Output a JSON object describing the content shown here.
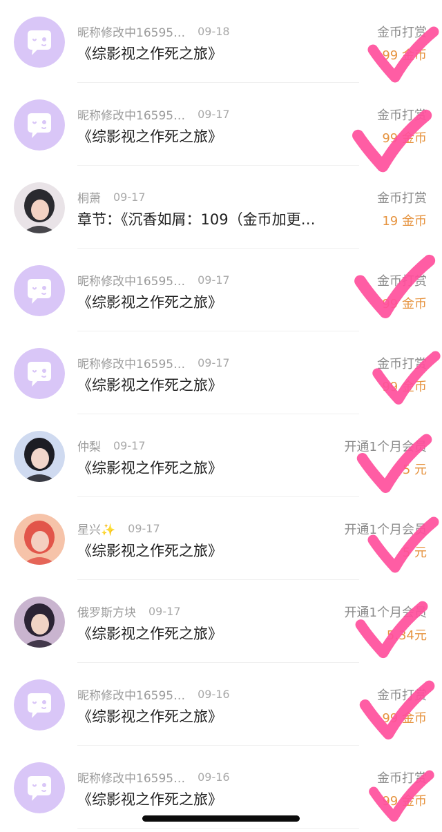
{
  "items": [
    {
      "name": "昵称修改中16595…",
      "date": "09-18",
      "title": "《综影视之作死之旅》",
      "action": "金币打赏",
      "amount": "99 金币",
      "avatar": "bubble-avatar-icon",
      "checked": true
    },
    {
      "name": "昵称修改中16595…",
      "date": "09-17",
      "title": "《综影视之作死之旅》",
      "action": "金币打赏",
      "amount": "99 金币",
      "avatar": "bubble-avatar-icon",
      "checked": true
    },
    {
      "name": "桐萧",
      "date": "09-17",
      "title": "章节：《沉香如屑：109（金币加更…",
      "action": "金币打赏",
      "amount": "19 金币",
      "avatar": "user-photo-avatar",
      "checked": false
    },
    {
      "name": "昵称修改中16595…",
      "date": "09-17",
      "title": "《综影视之作死之旅》",
      "action": "金币打赏",
      "amount": "99 金币",
      "avatar": "bubble-avatar-icon",
      "checked": true
    },
    {
      "name": "昵称修改中16595…",
      "date": "09-17",
      "title": "《综影视之作死之旅》",
      "action": "金币打赏",
      "amount": "99 金币",
      "avatar": "bubble-avatar-icon",
      "checked": true
    },
    {
      "name": "仲梨",
      "date": "09-17",
      "title": "《综影视之作死之旅》",
      "action": "开通1个月会员",
      "amount": "5 元",
      "avatar": "user-photo-avatar",
      "checked": true
    },
    {
      "name": "星兴✨",
      "date": "09-17",
      "title": "《综影视之作死之旅》",
      "action": "开通1个月会员",
      "amount": "5 元",
      "avatar": "user-photo-avatar",
      "checked": true
    },
    {
      "name": "俄罗斯方块",
      "date": "09-17",
      "title": "《综影视之作死之旅》",
      "action": "开通1个月会员",
      "amount": "5.34元",
      "avatar": "user-photo-avatar",
      "checked": true
    },
    {
      "name": "昵称修改中16595…",
      "date": "09-16",
      "title": "《综影视之作死之旅》",
      "action": "金币打赏",
      "amount": "99 金币",
      "avatar": "bubble-avatar-icon",
      "checked": true
    },
    {
      "name": "昵称修改中16595…",
      "date": "09-16",
      "title": "《综影视之作死之旅》",
      "action": "金币打赏",
      "amount": "99 金币",
      "avatar": "bubble-avatar-icon",
      "checked": true
    }
  ],
  "colors": {
    "checkmark": "#ff4f9c",
    "amount": "#e6933f",
    "bubble_bg": "#d9c6f7",
    "bubble_icon": "#ffffff"
  }
}
